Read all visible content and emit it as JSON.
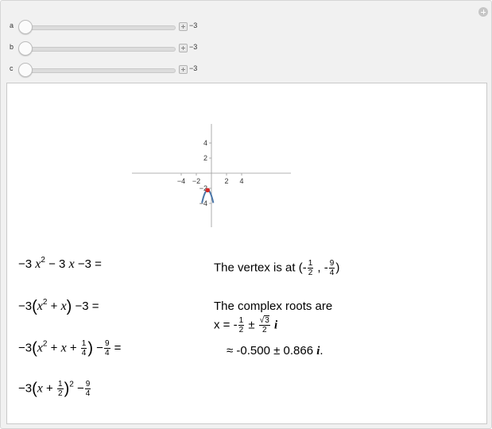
{
  "controls": {
    "sliders": [
      {
        "label": "a",
        "value": "−3"
      },
      {
        "label": "b",
        "value": "−3"
      },
      {
        "label": "c",
        "value": "−3"
      }
    ]
  },
  "chart_data": {
    "type": "line",
    "series": [
      {
        "x": [
          -0.25,
          -0.5,
          -0.75
        ],
        "y": [
          -5.4375,
          -2.25,
          -5.4375
        ],
        "shape": "parabola -3x^2-3x-3",
        "color": "#4a76a8"
      }
    ],
    "vertex_point": {
      "x": -0.5,
      "y": -2.25,
      "color": "#d62a2a"
    },
    "xlim": [
      -5.5,
      5.5
    ],
    "ylim": [
      -5.5,
      5.5
    ],
    "x_ticks": [
      "−4",
      "−2",
      "2",
      "4"
    ],
    "y_ticks": [
      "4",
      "2",
      "−2",
      "−4"
    ]
  },
  "left_steps": {
    "step1": {
      "text": "−3 x2 − 3 x −3 =",
      "coef": "−3",
      "pow": "2",
      "rest1": " − 3 ",
      "x": "x",
      "rest2": " −3 ="
    },
    "step2": {
      "coef": "−3",
      "inner": "x",
      "pow": "2",
      "plusx": " + x",
      "tail": " −3 ="
    },
    "step3": {
      "coef": "−3",
      "inner": "x",
      "pow": "2",
      "plusx": " + x + ",
      "frac_num": "1",
      "frac_den": "4",
      "minus": " −",
      "frac2_num": "9",
      "frac2_den": "4",
      "eq": " ="
    },
    "step4": {
      "coef": "−3",
      "inner": "x + ",
      "frac_num": "1",
      "frac_den": "2",
      "pow": "2",
      "minus": " −",
      "frac2_num": "9",
      "frac2_den": "4"
    }
  },
  "right_text": {
    "vertex_prefix": "The vertex is at (-",
    "vertex_xnum": "1",
    "vertex_xden": "2",
    "vertex_mid": " , -",
    "vertex_ynum": "9",
    "vertex_yden": "4",
    "vertex_suffix": ")",
    "roots_heading": "The complex  roots are",
    "roots_prefix": "x = -",
    "roots_num1": "1",
    "roots_den1": "2",
    "roots_pm": " ± ",
    "roots_sqrt": "3",
    "roots_den2": "2",
    "roots_i": "i",
    "approx_text": "≈ -0.500 ± 0.866 ",
    "approx_i": "i",
    "approx_end": "."
  }
}
